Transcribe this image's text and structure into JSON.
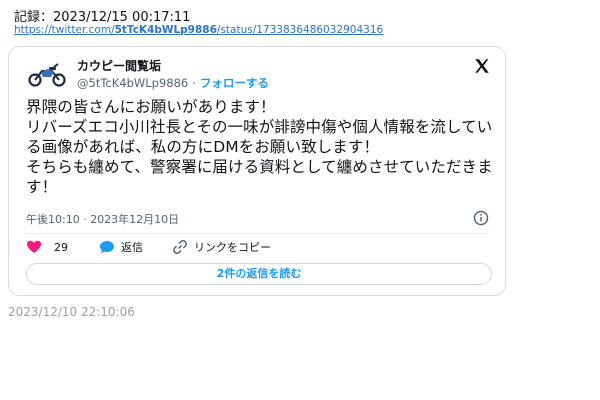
{
  "record": {
    "text": "記録：2023/12/15 00:17:11"
  },
  "status_url": {
    "prefix": "https://twitter.com/",
    "handle": "5tTcK4bWLp9886",
    "suffix": "/status/1733836486032904316"
  },
  "tweet": {
    "author_name": "カウピー閲覧垢",
    "handle": "@5tTcK4bWLp9886",
    "separator": "·",
    "follow_label": "フォローする",
    "text": "界隈の皆さんにお願いがあります！\nリバーズエコ小川社長とその一味が誹謗中傷や個人情報を流している画像があれば、私の方にDMをお願い致します！\nそちらも纏めて、警察署に届ける資料として纏めさせていただきます！",
    "timestamp": "午後10:10 · 2023年12月10日",
    "likes_count": "29",
    "reply_label": "返信",
    "copy_link_label": "リンクをコピー",
    "read_replies_label": "2件の返信を読む"
  },
  "footer": {
    "timestamp": "2023/12/10 22:10:06"
  },
  "colors": {
    "accent": "#1d9bf0",
    "like": "#f91880",
    "text": "#0f1419",
    "muted": "#536471"
  },
  "icons": [
    "motorbike-avatar-icon",
    "x-logo-icon",
    "info-icon",
    "heart-icon",
    "reply-bubble-icon",
    "link-icon"
  ]
}
